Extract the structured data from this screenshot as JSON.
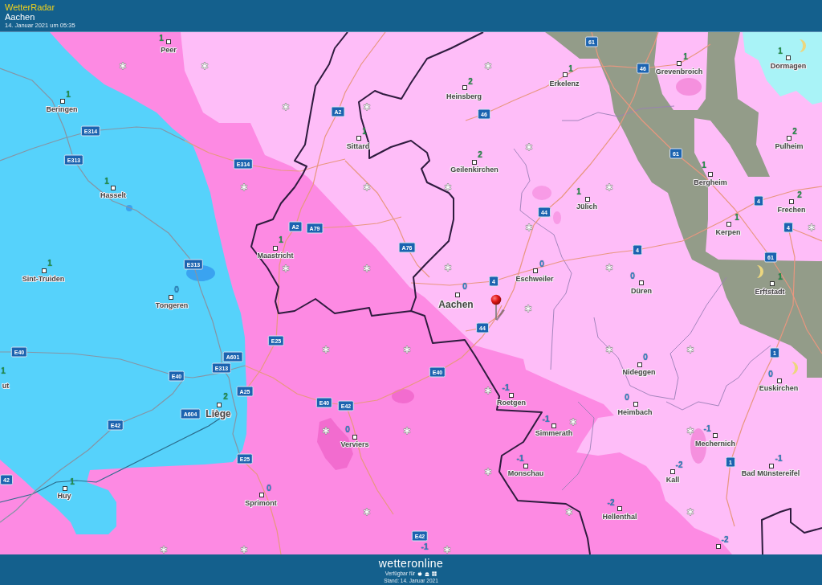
{
  "header": {
    "app_title": "WetterRadar",
    "location": "Aachen",
    "timestamp": "14. Januar 2021 um 05:35"
  },
  "map": {
    "cities": [
      {
        "name": "Peer",
        "value": "1",
        "color": "#23934a",
        "kind": "town"
      },
      {
        "name": "Grevenbroich",
        "value": "1",
        "color": "#23934a",
        "kind": "town"
      },
      {
        "name": "Dormagen",
        "value": "1",
        "color": "#23934a",
        "kind": "town"
      },
      {
        "name": "Erkelenz",
        "value": "1",
        "color": "#23934a",
        "kind": "town"
      },
      {
        "name": "Heinsberg",
        "value": "2",
        "color": "#23934a",
        "kind": "town"
      },
      {
        "name": "Beringen",
        "value": "1",
        "color": "#23934a",
        "kind": "town"
      },
      {
        "name": "Sittard",
        "value": "1",
        "color": "#23934a",
        "kind": "town"
      },
      {
        "name": "Pulheim",
        "value": "2",
        "color": "#23934a",
        "kind": "town"
      },
      {
        "name": "Geilenkirchen",
        "value": "2",
        "color": "#23934a",
        "kind": "town"
      },
      {
        "name": "Bergheim",
        "value": "1",
        "color": "#23934a",
        "kind": "town"
      },
      {
        "name": "Hasselt",
        "value": "1",
        "color": "#23934a",
        "kind": "town"
      },
      {
        "name": "Jülich",
        "value": "1",
        "color": "#23934a",
        "kind": "town"
      },
      {
        "name": "Frechen",
        "value": "2",
        "color": "#23934a",
        "kind": "town"
      },
      {
        "name": "Kerpen",
        "value": "1",
        "color": "#23934a",
        "kind": "town"
      },
      {
        "name": "Maastricht",
        "value": "1",
        "color": "#23934a",
        "kind": "town"
      },
      {
        "name": "Sint-Truiden",
        "value": "1",
        "color": "#23934a",
        "kind": "town"
      },
      {
        "name": "Eschweiler",
        "value": "0",
        "color": "#2f86c6",
        "kind": "town"
      },
      {
        "name": "Düren",
        "value": "0",
        "color": "#2f86c6",
        "kind": "town"
      },
      {
        "name": "Erftstadt",
        "value": "1",
        "color": "#23934a",
        "kind": "town"
      },
      {
        "name": "Tongeren",
        "value": "0",
        "color": "#2f86c6",
        "kind": "town"
      },
      {
        "name": "Aachen",
        "value": "0",
        "color": "#2f86c6",
        "kind": "city"
      },
      {
        "name": "Nideggen",
        "value": "0",
        "color": "#2f86c6",
        "kind": "town"
      },
      {
        "name": "ut",
        "value": "1",
        "color": "#23934a",
        "kind": "town"
      },
      {
        "name": "Euskirchen",
        "value": "0",
        "color": "#2f86c6",
        "kind": "town"
      },
      {
        "name": "Roetgen",
        "value": "-1",
        "color": "#2f86c6",
        "kind": "town"
      },
      {
        "name": "Liège",
        "value": "2",
        "color": "#23934a",
        "kind": "city"
      },
      {
        "name": "Heimbach",
        "value": "0",
        "color": "#2f86c6",
        "kind": "town"
      },
      {
        "name": "Simmerath",
        "value": "-1",
        "color": "#2f86c6",
        "kind": "town"
      },
      {
        "name": "Verviers",
        "value": "0",
        "color": "#2f86c6",
        "kind": "town"
      },
      {
        "name": "Mechernich",
        "value": "-1",
        "color": "#2f86c6",
        "kind": "town"
      },
      {
        "name": "Monschau",
        "value": "-1",
        "color": "#2f86c6",
        "kind": "town"
      },
      {
        "name": "Kall",
        "value": "-2",
        "color": "#2f86c6",
        "kind": "town"
      },
      {
        "name": "Bad Münstereifel",
        "value": "-1",
        "color": "#2f86c6",
        "kind": "town"
      },
      {
        "name": "Huy",
        "value": "1",
        "color": "#23934a",
        "kind": "town"
      },
      {
        "name": "Sprimont",
        "value": "0",
        "color": "#2f86c6",
        "kind": "town"
      },
      {
        "name": "Hellenthal",
        "value": "-2",
        "color": "#2f86c6",
        "kind": "town"
      },
      {
        "value": "-1",
        "color": "#2f86c6"
      },
      {
        "value": "-2",
        "color": "#2f86c6"
      }
    ],
    "road_signs": [
      "61",
      "46",
      "A2",
      "46",
      "E314",
      "61",
      "E313",
      "E314",
      "4",
      "44",
      "A2",
      "A79",
      "4",
      "A76",
      "4",
      "61",
      "E313",
      "4",
      "44",
      "E25",
      "E40",
      "1",
      "A601",
      "E313",
      "E40",
      "E40",
      "A25",
      "E40",
      "E42",
      "A604",
      "E42",
      "E25",
      "1",
      "42",
      "E42"
    ]
  },
  "footer": {
    "logo": "wetteronline",
    "availability": "Verfügbar für",
    "updated": "Stand: 14. Januar 2021"
  }
}
